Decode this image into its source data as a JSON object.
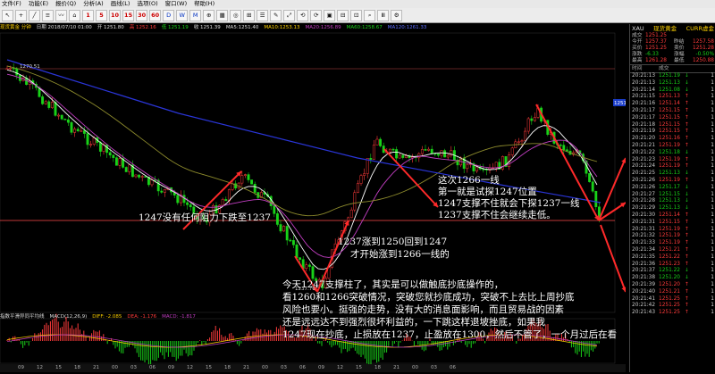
{
  "menu": {
    "items": [
      "文件(F)",
      "功能(E)",
      "报价(Q)",
      "分析(A)",
      "画线(L)",
      "选项(O)",
      "窗口(W)",
      "帮助(H)"
    ]
  },
  "toolbar": {
    "periods": [
      "1",
      "5",
      "10",
      "15",
      "30",
      "60",
      "D",
      "W",
      "M"
    ],
    "tools": [
      "↖",
      "+",
      "╱",
      "≡",
      "〰",
      "⌂",
      "⊕",
      "▦",
      "◎",
      "⊞",
      "☰",
      "✎",
      "⤢",
      "⟲",
      "⟳",
      "▣",
      "⊟",
      "⊡",
      "⌕",
      "Ⅲ",
      "⚙"
    ]
  },
  "chart": {
    "info": [
      "现货黄金 分钟",
      "日期 2018/07/10 01:00",
      "开 1251.80",
      "高 1252.16",
      "低 1251.19",
      "收 1251.39",
      "MA5:1251.40",
      "MA10:1253.13",
      "MA20:1256.89",
      "MA60:1258.67",
      "MA120:1261.33"
    ],
    "price_labels": {
      "high": "1270.51",
      "low": "1237.76",
      "current": "1251.5"
    },
    "indicator_info": [
      "指数平滑异同平均线",
      "MACD(12,26,9)",
      "DIFF: -2.085",
      "DEA: -1.176",
      "MACD: -1.817"
    ],
    "time_labels": [
      "09",
      "12",
      "15",
      "18",
      "21",
      "00",
      "03",
      "06",
      "09",
      "12",
      "15",
      "18",
      "21",
      "00",
      "03",
      "06",
      "09",
      "12",
      "15",
      "18",
      "21",
      "00",
      "03",
      "06"
    ]
  },
  "annotations": [
    {
      "text": "这次1266一线"
    },
    {
      "text": "第一就是试探1247位置"
    },
    {
      "text": "1247支撑不住就会下探1237一线"
    },
    {
      "text": "1237支撑不住会继续走低。"
    },
    {
      "text": "1247没有任何阻力下跌至1237"
    },
    {
      "text": "1237涨到1250回到1247"
    },
    {
      "text": "才开始涨到1266一线的"
    },
    {
      "text": "今天1247支撑柱了，其实是可以做触底抄底操作的，"
    },
    {
      "text": "看1260和1266突破情况，突破您就抄底成功，突破不上去比上周抄底"
    },
    {
      "text": "风险也要小。挺强的走势，没有大的消息面影响，而且贸易战的因素"
    },
    {
      "text": "还是远远达不到强烈很坏利益的，一下跳这样退坡挫底，如果我"
    },
    {
      "text": "1247现在抄底，止损放在1237，止盈放在1300，然后不管了，一个月过后在看"
    }
  ],
  "quote": {
    "symbol": "XAU",
    "name": "现货黄金",
    "currency": "CURR虚金",
    "rows": [
      {
        "k": "成交",
        "v": "1251.25",
        "k2": "",
        "v2": ""
      },
      {
        "k": "今开",
        "v": "1257.37",
        "k2": "昨结",
        "v2": "1257.58"
      },
      {
        "k": "买价",
        "v": "1251.25",
        "k2": "卖价",
        "v2": "1251.28"
      },
      {
        "k": "涨跌",
        "v": "-6.33",
        "k2": "涨幅",
        "v2": "-0.50%"
      },
      {
        "k": "最高",
        "v": "1261.28",
        "k2": "最低",
        "v2": "1250.88"
      }
    ],
    "tick_header": [
      "时间",
      "成交",
      "",
      ""
    ],
    "ticks": [
      {
        "t": "20:21:13",
        "p": "1251.19",
        "vol": "1",
        "dir": "down"
      },
      {
        "t": "20:21:13",
        "p": "1251.13",
        "vol": "1",
        "dir": "down"
      },
      {
        "t": "20:21:14",
        "p": "1251.08",
        "vol": "1",
        "dir": "down"
      },
      {
        "t": "20:21:15",
        "p": "1251.13",
        "vol": "1",
        "dir": "up"
      },
      {
        "t": "20:21:16",
        "p": "1251.14",
        "vol": "1",
        "dir": "up"
      },
      {
        "t": "20:21:17",
        "p": "1251.15",
        "vol": "1",
        "dir": "up"
      },
      {
        "t": "20:21:17",
        "p": "1251.15",
        "vol": "1",
        "dir": "up"
      },
      {
        "t": "20:21:18",
        "p": "1251.15",
        "vol": "1",
        "dir": "up"
      },
      {
        "t": "20:21:19",
        "p": "1251.15",
        "vol": "1",
        "dir": "up"
      },
      {
        "t": "20:21:20",
        "p": "1251.16",
        "vol": "1",
        "dir": "up"
      },
      {
        "t": "20:21:21",
        "p": "1251.19",
        "vol": "1",
        "dir": "up"
      },
      {
        "t": "20:21:22",
        "p": "1251.18",
        "vol": "1",
        "dir": "down"
      },
      {
        "t": "20:21:23",
        "p": "1251.19",
        "vol": "1",
        "dir": "up"
      },
      {
        "t": "20:21:24",
        "p": "1251.19",
        "vol": "1",
        "dir": "up"
      },
      {
        "t": "20:21:25",
        "p": "1251.13",
        "vol": "1",
        "dir": "down"
      },
      {
        "t": "20:21:26",
        "p": "1251.19",
        "vol": "1",
        "dir": "up"
      },
      {
        "t": "20:21:26",
        "p": "1251.17",
        "vol": "1",
        "dir": "down"
      },
      {
        "t": "20:21:27",
        "p": "1251.15",
        "vol": "1",
        "dir": "down"
      },
      {
        "t": "20:21:28",
        "p": "1251.13",
        "vol": "1",
        "dir": "down"
      },
      {
        "t": "20:21:29",
        "p": "1251.13",
        "vol": "1",
        "dir": "down"
      },
      {
        "t": "20:21:30",
        "p": "1251.14",
        "vol": "1",
        "dir": "up"
      },
      {
        "t": "20:21:31",
        "p": "1251.15",
        "vol": "1",
        "dir": "up"
      },
      {
        "t": "20:21:31",
        "p": "1251.19",
        "vol": "1",
        "dir": "up"
      },
      {
        "t": "20:21:32",
        "p": "1251.19",
        "vol": "1",
        "dir": "up"
      },
      {
        "t": "20:21:33",
        "p": "1251.19",
        "vol": "1",
        "dir": "up"
      },
      {
        "t": "20:21:34",
        "p": "1251.21",
        "vol": "1",
        "dir": "up"
      },
      {
        "t": "20:21:35",
        "p": "1251.22",
        "vol": "1",
        "dir": "up"
      },
      {
        "t": "20:21:36",
        "p": "1251.23",
        "vol": "1",
        "dir": "up"
      },
      {
        "t": "20:21:37",
        "p": "1251.22",
        "vol": "1",
        "dir": "down"
      },
      {
        "t": "20:21:38",
        "p": "1251.20",
        "vol": "1",
        "dir": "down"
      },
      {
        "t": "20:21:39",
        "p": "1251.20",
        "vol": "1",
        "dir": "up"
      },
      {
        "t": "20:21:40",
        "p": "1251.21",
        "vol": "1",
        "dir": "up"
      },
      {
        "t": "20:21:41",
        "p": "1251.25",
        "vol": "1",
        "dir": "up"
      },
      {
        "t": "20:21:42",
        "p": "1251.25",
        "vol": "1",
        "dir": "up"
      },
      {
        "t": "20:21:43",
        "p": "1251.25",
        "vol": "1",
        "dir": "up"
      }
    ]
  },
  "colors": {
    "up": "#ff3b3b",
    "down": "#19d219",
    "annotation_arrow": "#ff2a2a",
    "support_line": "#ff4a4a",
    "ma_blue": "#2a35d8",
    "ma_olive": "#8c8a2c",
    "ma_magenta": "#c23ec2"
  }
}
